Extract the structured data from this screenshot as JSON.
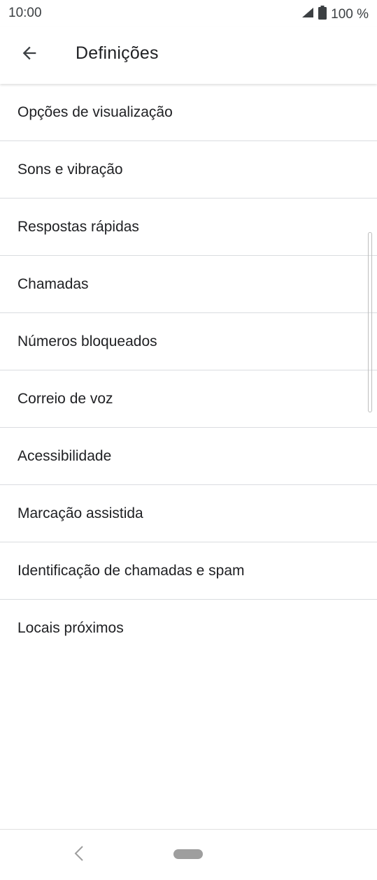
{
  "status_bar": {
    "time": "10:00",
    "battery": "100 %",
    "icons": [
      "signal-icon",
      "battery-icon"
    ]
  },
  "app_bar": {
    "title": "Definições",
    "back_icon": "arrow-back-icon"
  },
  "settings": {
    "items": [
      {
        "label": "Opções de visualização"
      },
      {
        "label": "Sons e vibração"
      },
      {
        "label": "Respostas rápidas"
      },
      {
        "label": "Chamadas"
      },
      {
        "label": "Números bloqueados"
      },
      {
        "label": "Correio de voz"
      },
      {
        "label": "Acessibilidade"
      },
      {
        "label": "Marcação assistida"
      },
      {
        "label": "Identificação de chamadas e spam"
      },
      {
        "label": "Locais próximos"
      }
    ]
  },
  "nav_bar": {
    "icons": [
      "nav-back-icon",
      "home-pill-icon"
    ]
  },
  "colors": {
    "text": "#202124",
    "divider": "#dadce0",
    "icon": "#3c4043"
  }
}
